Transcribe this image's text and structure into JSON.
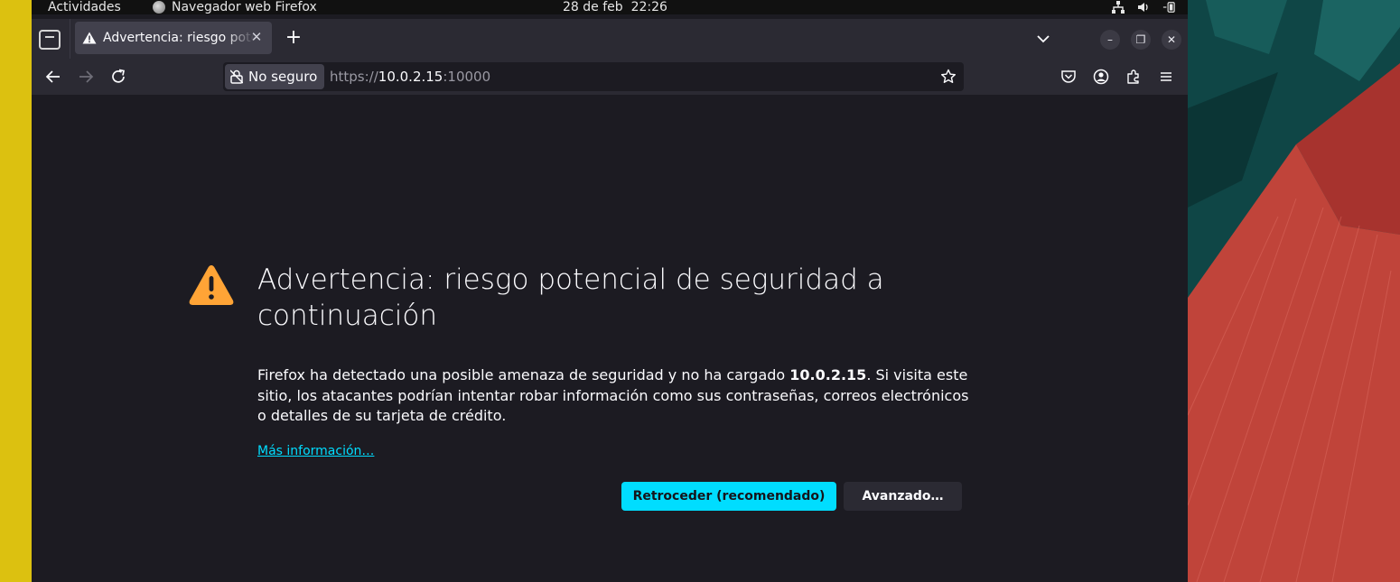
{
  "system_bar": {
    "activities": "Actividades",
    "app_name": "Navegador web Firefox",
    "app_icon": "firefox-icon",
    "date": "28 de feb",
    "time": "22:26",
    "tray_icons": [
      "network-icon",
      "volume-icon",
      "battery-icon"
    ]
  },
  "tab": {
    "title": "Advertencia: riesgo potencial de seguridad a continuación",
    "icon": "warning-icon",
    "close": "✕"
  },
  "new_tab": "+",
  "window_controls": {
    "minimize": "–",
    "restore": "❐",
    "close": "✕"
  },
  "url_bar": {
    "security_label": "No seguro",
    "scheme": "https://",
    "host": "10.0.2.15",
    "port": ":10000"
  },
  "toolbar_icons": [
    "pocket-icon",
    "account-icon",
    "extensions-icon",
    "menu-icon"
  ],
  "page": {
    "heading": "Advertencia: riesgo potencial de seguridad a continuación",
    "desc_before": "Firefox ha detectado una posible amenaza de seguridad y no ha cargado ",
    "desc_host": "10.0.2.15",
    "desc_after": ". Si visita este sitio, los atacantes podrían intentar robar información como sus contraseñas, correos electrónicos o detalles de su tarjeta de crédito.",
    "learn_more": "Más información…",
    "go_back": "Retroceder (recomendado)",
    "advanced": "Avanzado…"
  },
  "colors": {
    "accent": "#00ddff",
    "warning": "#ffa436",
    "background": "#1c1b22",
    "toolbar": "#2b2a33"
  }
}
